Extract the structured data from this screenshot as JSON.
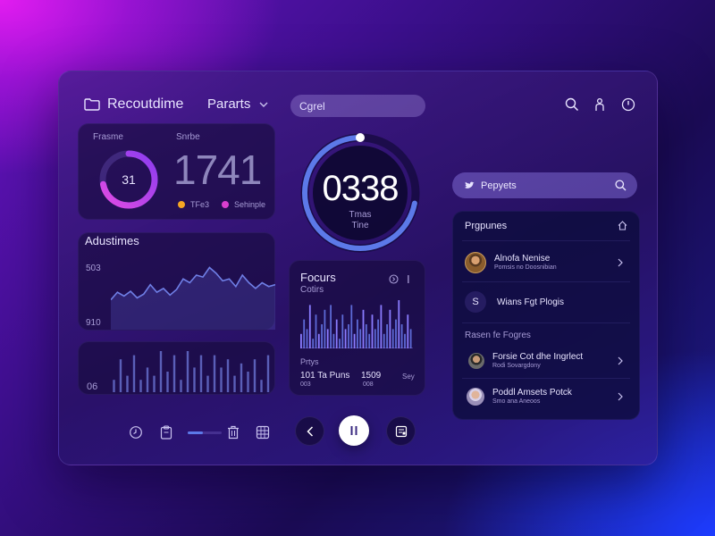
{
  "header": {
    "title": "Recoutdime",
    "menu_label": "Pararts",
    "search_placeholder": "Cgrel",
    "icons": [
      "folder-icon",
      "search-icon",
      "user-icon",
      "power-icon"
    ]
  },
  "stats": {
    "ring_label": "Frasme",
    "ring_value": "31",
    "ring_fraction": 0.72,
    "big_label": "Snrbe",
    "big_value": "1741",
    "legend": [
      {
        "label": "TFe3",
        "color": "#f5a623"
      },
      {
        "label": "Sehinple",
        "color": "#d93fcf"
      }
    ]
  },
  "timer": {
    "value": "0338",
    "label_line1": "Tmas",
    "label_line2": "Tine",
    "progress_fraction": 0.72
  },
  "line_chart": {
    "title": "Adustimes",
    "y_top": "503",
    "y_bottom": "910"
  },
  "bars_card": {
    "y_label": "06"
  },
  "focus": {
    "title": "Focurs",
    "subtitle": "Cotirs",
    "footer_label": "Prtys",
    "stat1": "101 Ta Puns",
    "stat1_sub": "003",
    "stat2": "1509",
    "stat2_sub": "008",
    "stat3": "Sey"
  },
  "right": {
    "search_label": "Pepyets",
    "list_title": "Prgpunes",
    "items": [
      {
        "name": "Alnofa Nenise",
        "sub": "Pomsis no Doosnibian"
      },
      {
        "name": "Wians Fgt Plogis",
        "sub": ""
      }
    ],
    "section2_title": "Rasen fe Fogres",
    "items2": [
      {
        "name": "Forsie Cot dhe Ingrlect",
        "sub": "Rodi Sovargdony"
      },
      {
        "name": "Poddl Amsets Potck",
        "sub": "Smo ana Aneoos"
      }
    ]
  },
  "player": {
    "progress_fraction": 0.45
  },
  "chart_data": [
    {
      "type": "line",
      "title": "Adustimes",
      "y_tick_labels": [
        "503",
        "910"
      ],
      "values": [
        22,
        30,
        26,
        31,
        24,
        28,
        38,
        30,
        34,
        27,
        33,
        44,
        40,
        48,
        46,
        56,
        50,
        42,
        44,
        36,
        48,
        40,
        34,
        40,
        36,
        38
      ]
    },
    {
      "type": "bar",
      "values": [
        3,
        8,
        4,
        9,
        3,
        6,
        4,
        10,
        5,
        9,
        3,
        10,
        6,
        9,
        4,
        9,
        6,
        8,
        4,
        7,
        5,
        8,
        3,
        9
      ]
    },
    {
      "type": "bar",
      "values": [
        3,
        6,
        4,
        9,
        2,
        7,
        3,
        5,
        8,
        4,
        9,
        3,
        6,
        2,
        7,
        4,
        5,
        9,
        3,
        6,
        4,
        8,
        5,
        3,
        7,
        4,
        6,
        9,
        3,
        5,
        8,
        4,
        6,
        10,
        5,
        3,
        7,
        4
      ]
    }
  ]
}
